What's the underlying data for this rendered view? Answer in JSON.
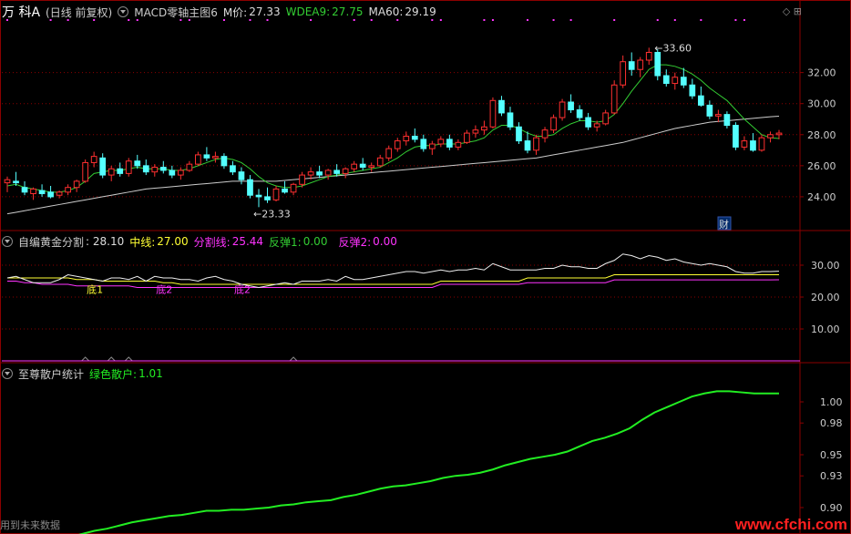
{
  "main": {
    "name": "万 科A",
    "period": "(日线 前复权)",
    "indicator": "MACD零轴主图6",
    "m_label": "M价:",
    "m_value": "27.33",
    "wdea_label": "WDEA9:",
    "wdea_value": "27.75",
    "ma60_label": "MA60:",
    "ma60_value": "29.19",
    "high_label": "33.60",
    "low_label": "23.33",
    "cai_label": "财",
    "y_ticks": [
      "32.00",
      "30.00",
      "28.00",
      "26.00",
      "24.00"
    ]
  },
  "panel2": {
    "name": "自编黄金分割",
    "v1_label": ": 28.10",
    "mid_label": "中线:",
    "mid_value": "27.00",
    "split_label": "分割线:",
    "split_value": "25.44",
    "fan1_label": "反弹1:",
    "fan1_value": "0.00",
    "fan2_label": "反弹2:",
    "fan2_value": "0.00",
    "di1": "底1",
    "di2": "底2",
    "y_ticks": [
      "30.00",
      "20.00",
      "10.00"
    ]
  },
  "panel3": {
    "name": "至尊散户统计",
    "green_label": "绿色散户:",
    "green_value": "1.01",
    "y_ticks": [
      "1.00",
      "0.98",
      "0.95",
      "0.93",
      "0.90"
    ]
  },
  "footer": {
    "left_text": "用到未来数据",
    "watermark": "www.cfchi.com"
  },
  "colors": {
    "up": "#ff3030",
    "down": "#54ffff",
    "ma_green": "#33cc33",
    "ma60": "#cccccc",
    "magenta": "#ff33ff",
    "yellow": "#ffff33",
    "frame": "#8b0000",
    "green_line": "#22ee22"
  },
  "chart_data": [
    {
      "type": "candlestick",
      "title": "万 科A (日线 前复权)",
      "ylim": [
        22.0,
        35.5
      ],
      "ohlc": [
        [
          24.9,
          25.3,
          24.3,
          25.1
        ],
        [
          25.0,
          25.6,
          24.7,
          24.9
        ],
        [
          24.6,
          25.0,
          24.1,
          24.3
        ],
        [
          24.2,
          24.6,
          23.8,
          24.5
        ],
        [
          24.4,
          24.8,
          24.0,
          24.2
        ],
        [
          24.3,
          24.7,
          23.9,
          24.0
        ],
        [
          24.1,
          24.4,
          23.9,
          24.3
        ],
        [
          24.3,
          24.8,
          24.1,
          24.6
        ],
        [
          24.6,
          25.1,
          24.3,
          25.0
        ],
        [
          25.0,
          26.4,
          24.9,
          26.2
        ],
        [
          26.2,
          26.9,
          25.9,
          26.6
        ],
        [
          26.5,
          26.8,
          25.2,
          25.4
        ],
        [
          25.4,
          26.0,
          25.0,
          25.8
        ],
        [
          25.8,
          26.2,
          25.3,
          25.5
        ],
        [
          25.5,
          26.5,
          25.3,
          26.3
        ],
        [
          26.3,
          26.7,
          25.8,
          26.0
        ],
        [
          26.0,
          26.4,
          25.4,
          25.6
        ],
        [
          25.6,
          26.1,
          25.3,
          25.9
        ],
        [
          25.9,
          26.3,
          25.5,
          25.7
        ],
        [
          25.7,
          26.0,
          25.2,
          25.4
        ],
        [
          25.4,
          25.9,
          25.1,
          25.7
        ],
        [
          25.7,
          26.3,
          25.6,
          26.1
        ],
        [
          26.1,
          26.9,
          26.0,
          26.7
        ],
        [
          26.7,
          27.2,
          26.3,
          26.5
        ],
        [
          26.5,
          26.9,
          26.2,
          26.6
        ],
        [
          26.6,
          26.8,
          25.8,
          26.0
        ],
        [
          26.0,
          26.3,
          25.4,
          25.6
        ],
        [
          25.6,
          25.9,
          24.8,
          25.1
        ],
        [
          25.1,
          25.4,
          23.9,
          24.1
        ],
        [
          24.1,
          24.5,
          23.33,
          24.0
        ],
        [
          24.0,
          24.6,
          23.6,
          23.8
        ],
        [
          23.8,
          24.7,
          23.7,
          24.5
        ],
        [
          24.5,
          25.0,
          24.2,
          24.3
        ],
        [
          24.3,
          24.9,
          24.1,
          24.8
        ],
        [
          24.8,
          25.6,
          24.6,
          25.4
        ],
        [
          25.4,
          25.9,
          25.1,
          25.6
        ],
        [
          25.6,
          26.0,
          25.2,
          25.4
        ],
        [
          25.4,
          25.8,
          25.1,
          25.7
        ],
        [
          25.7,
          26.1,
          25.3,
          25.5
        ],
        [
          25.5,
          25.9,
          25.2,
          25.8
        ],
        [
          25.8,
          26.3,
          25.6,
          26.1
        ],
        [
          26.1,
          26.5,
          25.7,
          25.9
        ],
        [
          25.9,
          26.2,
          25.6,
          26.0
        ],
        [
          26.0,
          26.7,
          25.9,
          26.5
        ],
        [
          26.5,
          27.3,
          26.3,
          27.1
        ],
        [
          27.1,
          27.8,
          26.9,
          27.6
        ],
        [
          27.6,
          28.2,
          27.3,
          27.9
        ],
        [
          27.9,
          28.4,
          27.5,
          27.7
        ],
        [
          27.7,
          28.0,
          26.9,
          27.1
        ],
        [
          27.1,
          27.6,
          26.7,
          27.4
        ],
        [
          27.4,
          27.9,
          27.2,
          27.7
        ],
        [
          27.7,
          28.0,
          27.0,
          27.2
        ],
        [
          27.2,
          27.7,
          27.0,
          27.5
        ],
        [
          27.5,
          28.3,
          27.4,
          28.1
        ],
        [
          28.1,
          28.6,
          27.8,
          28.3
        ],
        [
          28.3,
          28.9,
          28.0,
          28.5
        ],
        [
          28.5,
          30.4,
          28.4,
          30.2
        ],
        [
          30.2,
          30.5,
          29.2,
          29.4
        ],
        [
          29.4,
          29.8,
          28.3,
          28.5
        ],
        [
          28.5,
          28.8,
          27.4,
          27.6
        ],
        [
          27.6,
          28.2,
          26.8,
          27.0
        ],
        [
          27.0,
          28.0,
          26.7,
          27.8
        ],
        [
          27.8,
          28.5,
          27.5,
          28.3
        ],
        [
          28.3,
          29.3,
          28.1,
          29.1
        ],
        [
          29.1,
          30.3,
          28.9,
          30.1
        ],
        [
          30.1,
          30.6,
          29.4,
          29.6
        ],
        [
          29.6,
          29.9,
          28.9,
          29.1
        ],
        [
          29.1,
          29.4,
          28.3,
          28.5
        ],
        [
          28.5,
          28.9,
          28.2,
          28.7
        ],
        [
          28.7,
          29.6,
          28.6,
          29.4
        ],
        [
          29.4,
          31.5,
          29.3,
          31.2
        ],
        [
          31.2,
          33.1,
          31.0,
          32.7
        ],
        [
          32.7,
          33.3,
          31.8,
          32.2
        ],
        [
          32.2,
          33.0,
          31.7,
          32.8
        ],
        [
          32.8,
          33.6,
          32.5,
          33.3
        ],
        [
          33.3,
          33.5,
          31.5,
          31.8
        ],
        [
          31.8,
          32.2,
          31.1,
          31.3
        ],
        [
          31.3,
          32.0,
          30.9,
          31.7
        ],
        [
          31.7,
          32.3,
          31.0,
          31.2
        ],
        [
          31.2,
          31.6,
          30.3,
          30.5
        ],
        [
          30.5,
          31.1,
          29.8,
          29.9
        ],
        [
          29.9,
          30.2,
          29.0,
          29.2
        ],
        [
          29.2,
          29.6,
          28.8,
          29.3
        ],
        [
          29.3,
          29.5,
          28.4,
          28.6
        ],
        [
          28.6,
          28.8,
          27.0,
          27.2
        ],
        [
          27.2,
          27.9,
          27.0,
          27.6
        ],
        [
          27.6,
          28.1,
          26.9,
          27.0
        ],
        [
          27.0,
          28.0,
          26.9,
          27.8
        ],
        [
          27.8,
          28.2,
          27.5,
          28.0
        ],
        [
          28.0,
          28.3,
          27.7,
          28.1
        ]
      ],
      "series": [
        {
          "name": "M价",
          "values": [
            24.7,
            24.8,
            24.6,
            24.5,
            24.4,
            24.3,
            24.3,
            24.4,
            24.6,
            25.0,
            25.5,
            25.6,
            25.7,
            25.7,
            25.8,
            25.9,
            25.8,
            25.8,
            25.8,
            25.7,
            25.7,
            25.8,
            26.0,
            26.2,
            26.4,
            26.5,
            26.4,
            26.2,
            25.8,
            25.3,
            24.9,
            24.7,
            24.6,
            24.6,
            24.7,
            24.9,
            25.1,
            25.3,
            25.4,
            25.5,
            25.6,
            25.7,
            25.8,
            25.9,
            26.2,
            26.5,
            26.9,
            27.2,
            27.3,
            27.3,
            27.4,
            27.4,
            27.4,
            27.5,
            27.6,
            27.8,
            28.3,
            28.6,
            28.6,
            28.4,
            28.1,
            27.9,
            27.9,
            28.0,
            28.4,
            28.7,
            28.9,
            28.9,
            28.8,
            28.9,
            29.3,
            30.0,
            30.8,
            31.5,
            32.2,
            32.5,
            32.5,
            32.4,
            32.2,
            31.9,
            31.5,
            31.0,
            30.6,
            30.2,
            29.6,
            29.0,
            28.5,
            28.0,
            27.8,
            27.75
          ]
        },
        {
          "name": "MA60",
          "values": [
            22.9,
            23.0,
            23.1,
            23.2,
            23.3,
            23.4,
            23.5,
            23.6,
            23.7,
            23.8,
            23.9,
            24.0,
            24.1,
            24.2,
            24.3,
            24.4,
            24.5,
            24.55,
            24.6,
            24.65,
            24.7,
            24.75,
            24.8,
            24.85,
            24.9,
            24.95,
            25.0,
            25.0,
            25.0,
            25.0,
            25.0,
            25.0,
            25.05,
            25.1,
            25.15,
            25.2,
            25.25,
            25.3,
            25.35,
            25.4,
            25.45,
            25.5,
            25.55,
            25.6,
            25.65,
            25.7,
            25.75,
            25.8,
            25.85,
            25.9,
            25.95,
            26.0,
            26.05,
            26.1,
            26.15,
            26.2,
            26.25,
            26.3,
            26.35,
            26.4,
            26.45,
            26.5,
            26.6,
            26.7,
            26.8,
            26.9,
            27.0,
            27.1,
            27.2,
            27.3,
            27.4,
            27.5,
            27.65,
            27.8,
            27.95,
            28.1,
            28.25,
            28.4,
            28.5,
            28.6,
            28.7,
            28.8,
            28.85,
            28.9,
            28.95,
            29.0,
            29.05,
            29.1,
            29.15,
            29.19
          ]
        }
      ]
    },
    {
      "type": "line",
      "title": "自编黄金分割",
      "ylim": [
        0,
        36
      ],
      "series": [
        {
          "name": "自编黄金分割",
          "values": [
            26,
            26.5,
            25.5,
            24.5,
            24.5,
            24.5,
            25.5,
            27,
            26.5,
            26,
            25.5,
            25,
            26,
            26,
            25.5,
            26.5,
            25,
            26.5,
            26,
            26,
            25.5,
            25.5,
            25,
            26,
            26.5,
            25.5,
            25,
            24,
            23.5,
            23,
            23.5,
            24,
            24.5,
            24,
            25,
            25,
            25,
            25.5,
            25,
            26.5,
            25.5,
            25.5,
            26,
            26.5,
            27,
            27.5,
            28,
            28,
            27.5,
            28,
            28.5,
            28,
            28.5,
            28.5,
            29,
            28.5,
            30.5,
            29.5,
            28.5,
            28.5,
            28.5,
            28.5,
            29,
            29,
            30,
            29.5,
            29.5,
            29,
            29,
            30.5,
            31.5,
            33.5,
            33,
            32,
            33,
            32.5,
            31.5,
            32,
            31,
            30.5,
            30,
            30.5,
            30,
            29.5,
            28,
            27.5,
            27.5,
            28,
            28,
            28.1
          ]
        },
        {
          "name": "中线",
          "values": [
            26,
            26,
            26,
            26,
            26,
            26,
            26,
            26,
            25.5,
            25.5,
            25.5,
            25,
            25,
            25,
            25,
            25,
            25,
            25,
            24.5,
            24.5,
            24,
            24,
            24,
            24,
            24,
            24,
            24,
            24,
            24,
            24,
            24,
            24,
            24,
            24,
            24,
            24,
            24,
            24,
            24,
            24,
            24,
            24,
            24,
            24,
            24,
            24,
            24,
            24,
            24,
            24,
            25,
            25,
            25,
            25,
            25,
            25,
            25,
            25,
            25,
            25,
            26,
            26,
            26,
            26,
            26,
            26,
            26,
            26,
            26,
            26,
            27,
            27,
            27,
            27,
            27,
            27,
            27,
            27,
            27,
            27,
            27,
            27,
            27,
            27,
            27,
            27,
            27,
            27,
            27,
            27.0
          ]
        },
        {
          "name": "分割线",
          "values": [
            25,
            25,
            24.5,
            24.5,
            24,
            24,
            24,
            24,
            23.5,
            23.5,
            23.5,
            23.5,
            23.5,
            23.5,
            23.5,
            23,
            23,
            23,
            23,
            23,
            23,
            23,
            23,
            23,
            23,
            23,
            23,
            23,
            23,
            23,
            23,
            23,
            23,
            23,
            23,
            23,
            23,
            23,
            23,
            23,
            23,
            23,
            23,
            23,
            23,
            23,
            23,
            23,
            23,
            23,
            24,
            24,
            24,
            24,
            24,
            24,
            24,
            24,
            24,
            24,
            24.5,
            24.5,
            24.5,
            24.5,
            24.5,
            24.5,
            24.5,
            24.5,
            24.5,
            24.5,
            25.4,
            25.4,
            25.4,
            25.4,
            25.4,
            25.4,
            25.4,
            25.4,
            25.4,
            25.4,
            25.4,
            25.4,
            25.4,
            25.4,
            25.4,
            25.4,
            25.4,
            25.4,
            25.4,
            25.44
          ]
        }
      ]
    },
    {
      "type": "line",
      "title": "至尊散户统计",
      "ylim": [
        0.875,
        1.025
      ],
      "series": [
        {
          "name": "绿色散户",
          "values": [
            0.852,
            0.856,
            0.861,
            0.865,
            0.868,
            0.872,
            0.875,
            0.878,
            0.88,
            0.883,
            0.886,
            0.888,
            0.89,
            0.892,
            0.893,
            0.895,
            0.897,
            0.897,
            0.898,
            0.898,
            0.899,
            0.9,
            0.902,
            0.903,
            0.905,
            0.906,
            0.907,
            0.91,
            0.912,
            0.915,
            0.918,
            0.92,
            0.921,
            0.923,
            0.925,
            0.928,
            0.93,
            0.931,
            0.933,
            0.936,
            0.94,
            0.943,
            0.946,
            0.948,
            0.95,
            0.953,
            0.958,
            0.963,
            0.966,
            0.97,
            0.975,
            0.983,
            0.99,
            0.995,
            1.0,
            1.005,
            1.008,
            1.01,
            1.01,
            1.009,
            1.008,
            1.008,
            1.008
          ]
        }
      ]
    }
  ]
}
